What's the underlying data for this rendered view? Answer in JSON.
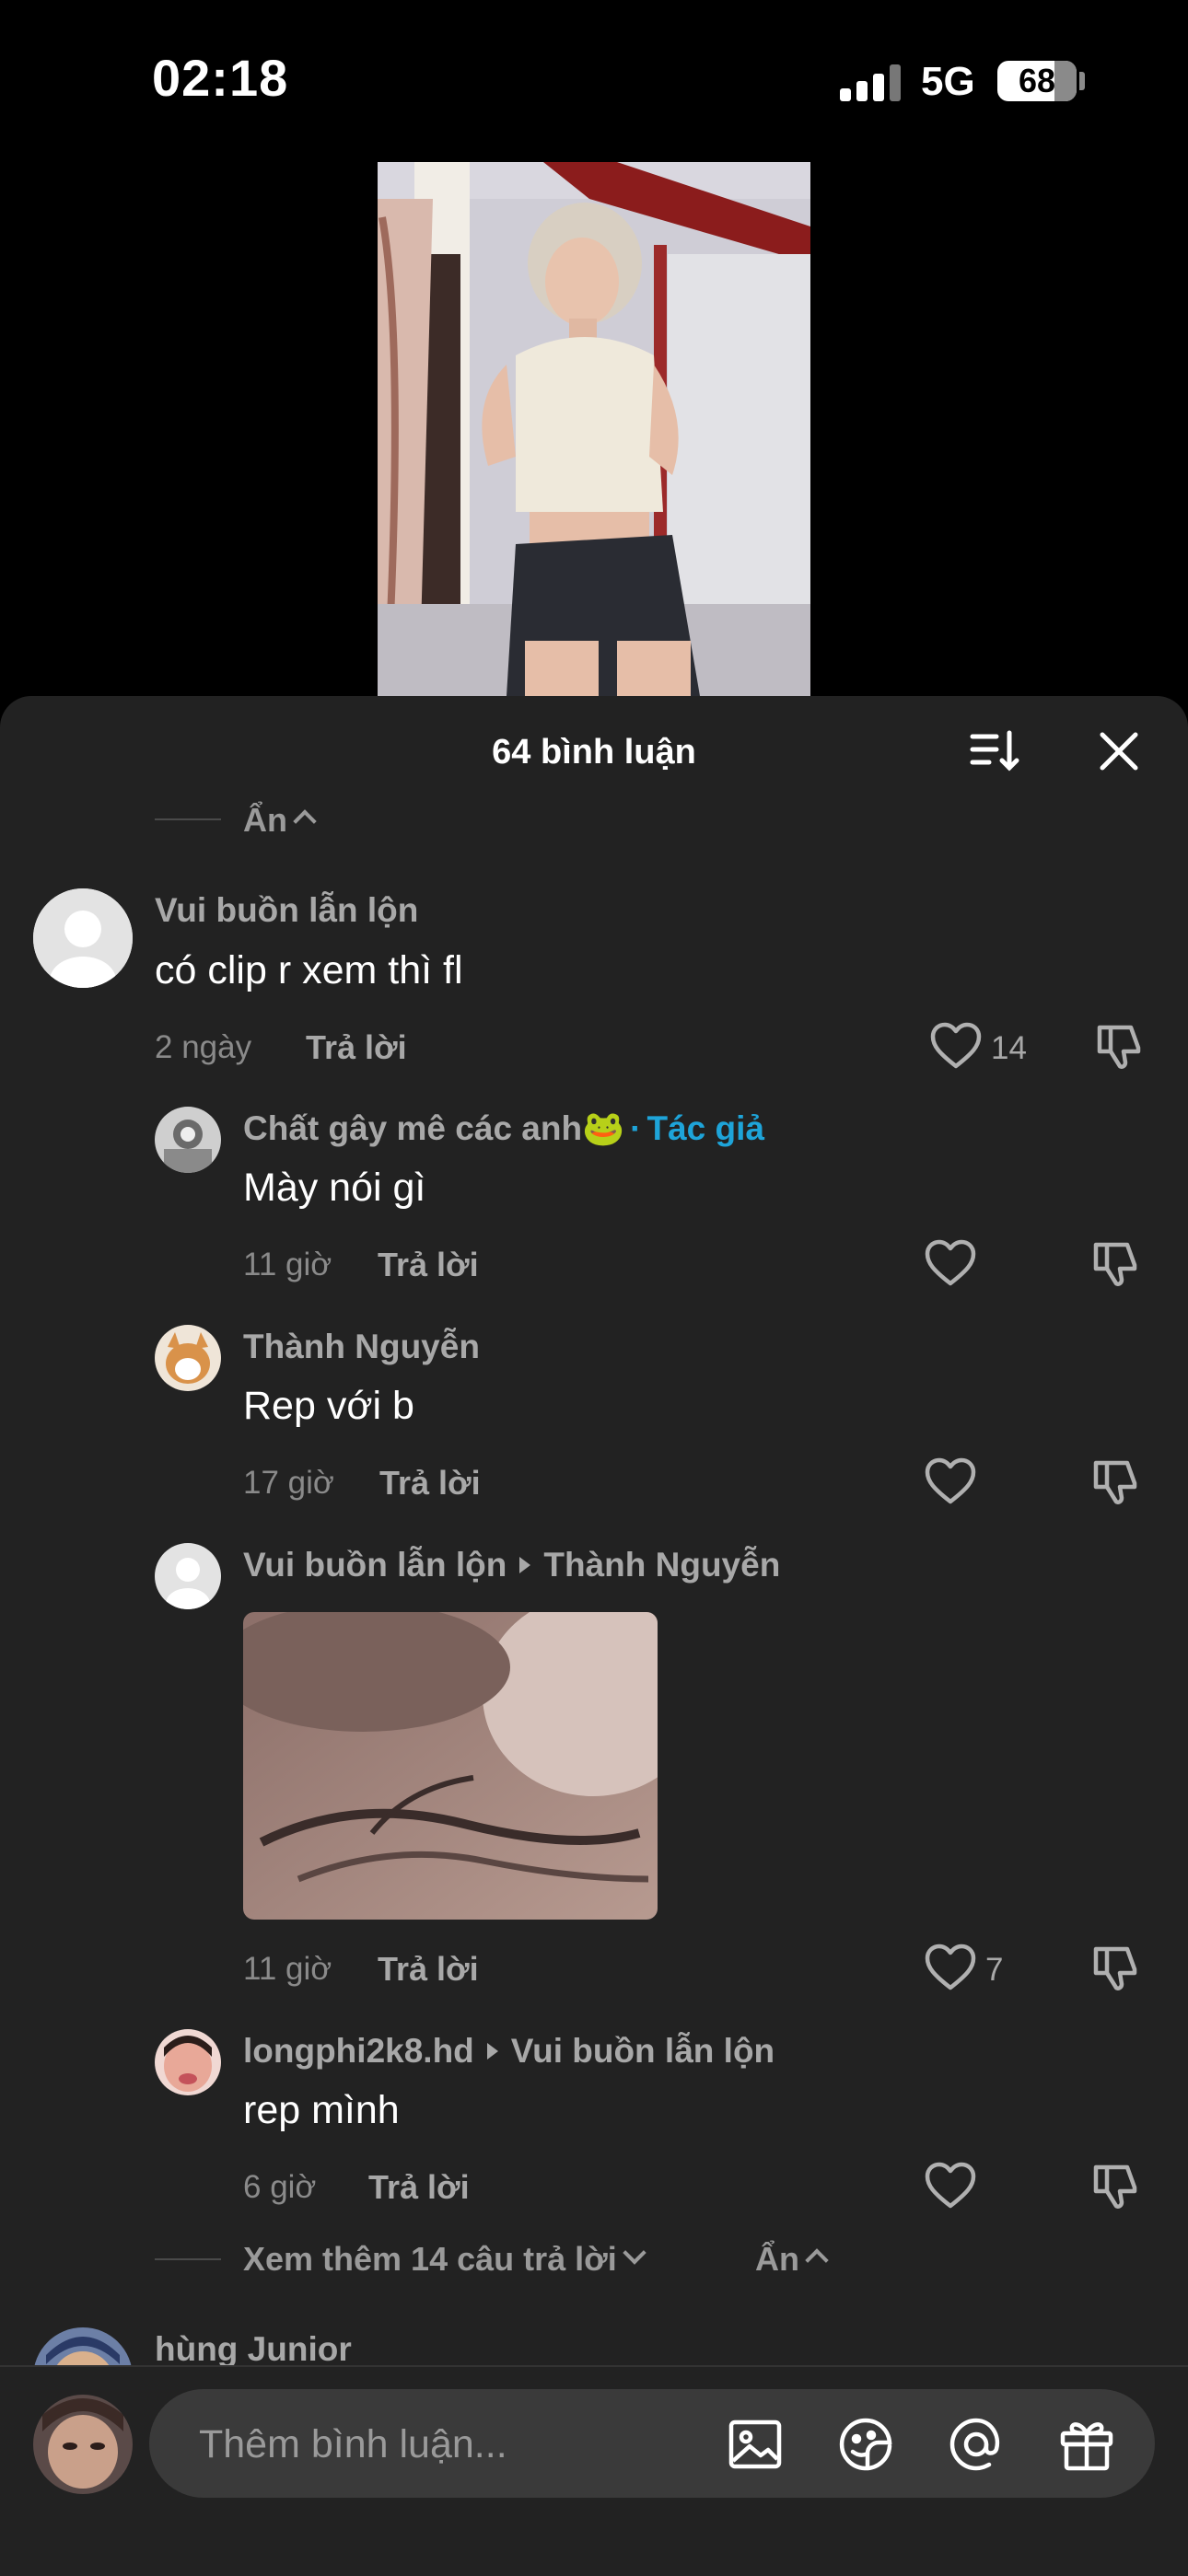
{
  "status_bar": {
    "time": "02:18",
    "network": "5G",
    "battery": "68"
  },
  "panel": {
    "title": "64 bình luận"
  },
  "collapse_top": {
    "label": "Ẩn"
  },
  "comments": [
    {
      "user": "Vui buồn lẫn lộn",
      "text": "có clip r xem thì fl",
      "time": "2 ngày",
      "reply": "Trả lời",
      "likes": "14"
    },
    {
      "user": "Chất gây mê các anh🐸",
      "author_badge": "Tác giả",
      "author_sep": "·",
      "text": "Mày nói gì",
      "time": "11 giờ",
      "reply": "Trả lời"
    },
    {
      "user": "Thành Nguyễn",
      "text": "Rep với b",
      "time": "17 giờ",
      "reply": "Trả lời"
    },
    {
      "user": "Vui buồn lẫn lộn",
      "reply_to": "Thành Nguyễn",
      "time": "11 giờ",
      "reply": "Trả lời",
      "likes": "7"
    },
    {
      "user": "longphi2k8.hd",
      "reply_to": "Vui buồn lẫn lộn",
      "text": "rep mình",
      "time": "6 giờ",
      "reply": "Trả lời"
    }
  ],
  "more_replies": {
    "label": "Xem thêm 14 câu trả lời",
    "hide": "Ẩn"
  },
  "next_comment": {
    "user": "hùng Junior"
  },
  "composer": {
    "placeholder": "Thêm bình luận..."
  },
  "icons": {
    "sort": "sort-icon",
    "close": "close-icon",
    "like": "heart-outline-icon",
    "dislike": "thumbs-down-icon",
    "image": "image-icon",
    "emoji": "sticker-emoji-icon",
    "mention": "at-icon",
    "gift": "gift-icon"
  }
}
